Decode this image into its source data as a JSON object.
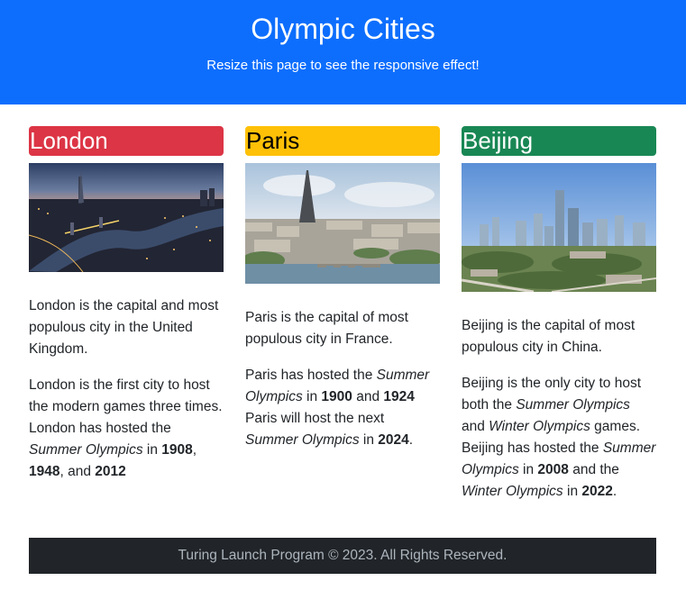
{
  "header": {
    "title": "Olympic Cities",
    "subtitle": "Resize this page to see the responsive effect!"
  },
  "cities": [
    {
      "name": "London",
      "color": "#dc3545",
      "image": "london-skyline-photo",
      "para1": "London is the capital and most populous city in the United Kingdom.",
      "para2": {
        "a": "London is the first city to host the modern games three times. London has hosted the ",
        "b": "Summer Olympics",
        "c": " in ",
        "y1": "1908",
        "sep1": ", ",
        "y2": "1948",
        "sep2": ", and ",
        "y3": "2012"
      }
    },
    {
      "name": "Paris",
      "color": "#ffc107",
      "image": "paris-eiffel-tower-photo",
      "para1": "Paris is the capital of most populous city in France.",
      "para2": {
        "a": "Paris has hosted the ",
        "b": "Summer Olympics",
        "c": " in ",
        "y1": "1900",
        "sep1": " and ",
        "y2": "1924",
        "d": " Paris will host the next ",
        "e": "Summer Olympics",
        "f": " in ",
        "y3": "2024",
        "end": "."
      }
    },
    {
      "name": "Beijing",
      "color": "#198754",
      "image": "beijing-cityscape-photo",
      "para1": "Beijing is the capital of most populous city in China.",
      "para2": {
        "a": "Beijing is the only city to host both the ",
        "b": "Summer Olympics",
        "c": " and ",
        "d": "Winter Olympics",
        "e": " games. Beijing has hosted the ",
        "f": "Summer Olympics",
        "g": " in ",
        "y1": "2008",
        "h": " and the ",
        "i": "Winter Olympics",
        "j": " in ",
        "y2": "2022",
        "end": "."
      }
    }
  ],
  "footer": {
    "text": "Turing Launch Program © 2023. All Rights Reserved."
  }
}
